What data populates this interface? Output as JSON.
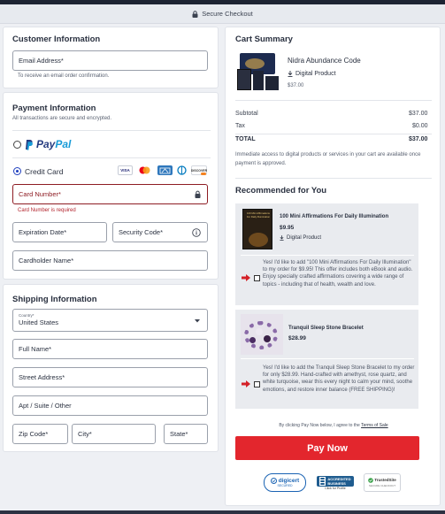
{
  "secure_bar": {
    "label": "Secure Checkout"
  },
  "customer": {
    "title": "Customer Information",
    "email_label": "Email Address*",
    "email_hint": "To receive an email order confirmation."
  },
  "payment": {
    "title": "Payment Information",
    "subtitle": "All transactions are secure and encrypted.",
    "paypal_pay": "Pay",
    "paypal_pal": "Pal",
    "credit_label": "Credit Card",
    "card_logos": [
      "VISA",
      "MC",
      "AMEX",
      "DINERS",
      "DISCOVER"
    ],
    "card_number_label": "Card Number*",
    "card_number_error": "Card Number is required",
    "expiration_label": "Expiration Date*",
    "security_label": "Security Code*",
    "cardholder_label": "Cardholder Name*"
  },
  "shipping": {
    "title": "Shipping Information",
    "country_label": "Country*",
    "country_value": "United States",
    "full_name_label": "Full Name*",
    "street_label": "Street Address*",
    "apt_label": "Apt / Suite / Other",
    "zip_label": "Zip Code*",
    "city_label": "City*",
    "state_label": "State*"
  },
  "cart": {
    "title": "Cart Summary",
    "product_name": "Nidra Abundance Code",
    "product_type": "Digital Product",
    "product_price": "$37.00",
    "subtotal_label": "Subtotal",
    "subtotal_value": "$37.00",
    "tax_label": "Tax",
    "tax_value": "$0.00",
    "total_label": "TOTAL",
    "total_value": "$37.00",
    "access_note": "Immediate access to digital products or services in your cart are available once payment is approved."
  },
  "recommended": {
    "title": "Recommended for You",
    "items": [
      {
        "name": "100 Mini Affirmations For Daily Illumination",
        "price": "$9.95",
        "type": "Digital Product",
        "thumb_text": "100 Mini Affirmations For Daily Illumination",
        "offer": "Yes! I'd like to add \"100 Mini Affirmations For Daily Illumination\" to my order for $9.95! This offer includes both eBook and audio. Enjoy specially crafted affirmations covering a wide range of topics - including that of health, wealth and love."
      },
      {
        "name": "Tranquil Sleep Stone Bracelet",
        "price": "$28.99",
        "offer": "Yes! I'd like to add the Tranquil Sleep Stone Bracelet to my order for only $28.99. Hand-crafted with amethyst, rose quartz, and white turquoise, wear this every night to calm your mind, soothe emotions, and restore inner balance (FREE SHIPPING)!"
      }
    ]
  },
  "terms": {
    "prefix": "By clicking Pay Now below, I agree to the",
    "link": "Terms of Sale"
  },
  "pay_button": "Pay Now",
  "badges": {
    "digicert": "digicert",
    "digicert_sub": "SECURED",
    "bbb_line1": "ACCREDITED",
    "bbb_line2": "BUSINESS",
    "bbb_sub": "Click for Profile",
    "trusted": "TrustedSite",
    "trusted_sub": "SECURE CHECKOUT"
  }
}
